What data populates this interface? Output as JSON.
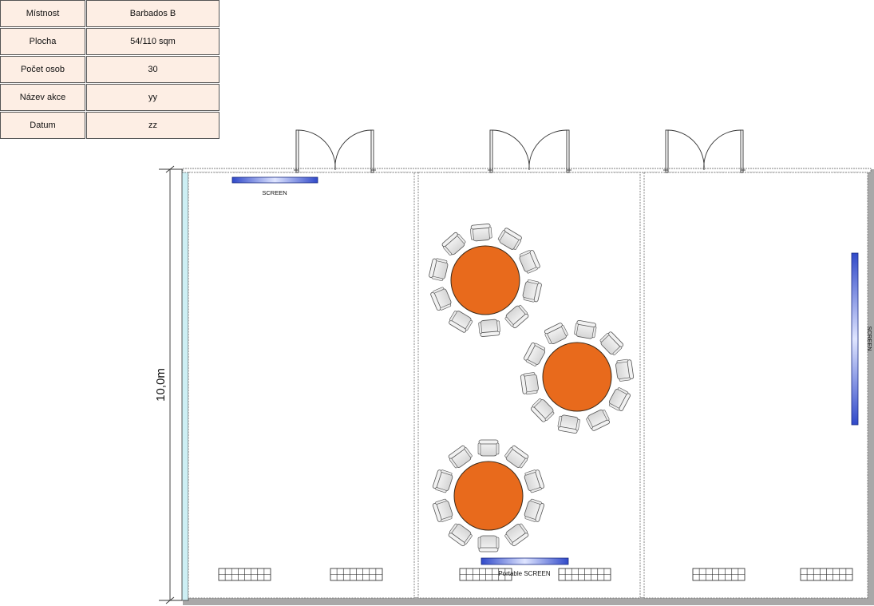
{
  "info_table": {
    "rows": [
      {
        "label": "Místnost",
        "value": "Barbados B"
      },
      {
        "label": "Plocha",
        "value": "54/110 sqm"
      },
      {
        "label": "Počet osob",
        "value": "30"
      },
      {
        "label": "Název akce",
        "value": "yy"
      },
      {
        "label": "Datum",
        "value": "zz"
      }
    ]
  },
  "floor_plan": {
    "dimension_label": "10,0m",
    "screen_left_label": "SCREEN",
    "screen_right_label": "SCREEN",
    "portable_screen_label": "Portable SCREEN",
    "tables": {
      "count": 3,
      "chairs_per_table": 10
    },
    "colors": {
      "table_fill": "#e86a1c",
      "screen_fill": "#3a55d6",
      "chair_fill": "#e6e6e6",
      "window_wall": "#cdeff4",
      "wall_shadow": "#a8a8a8",
      "table_info_bg": "#fdeee4"
    }
  }
}
